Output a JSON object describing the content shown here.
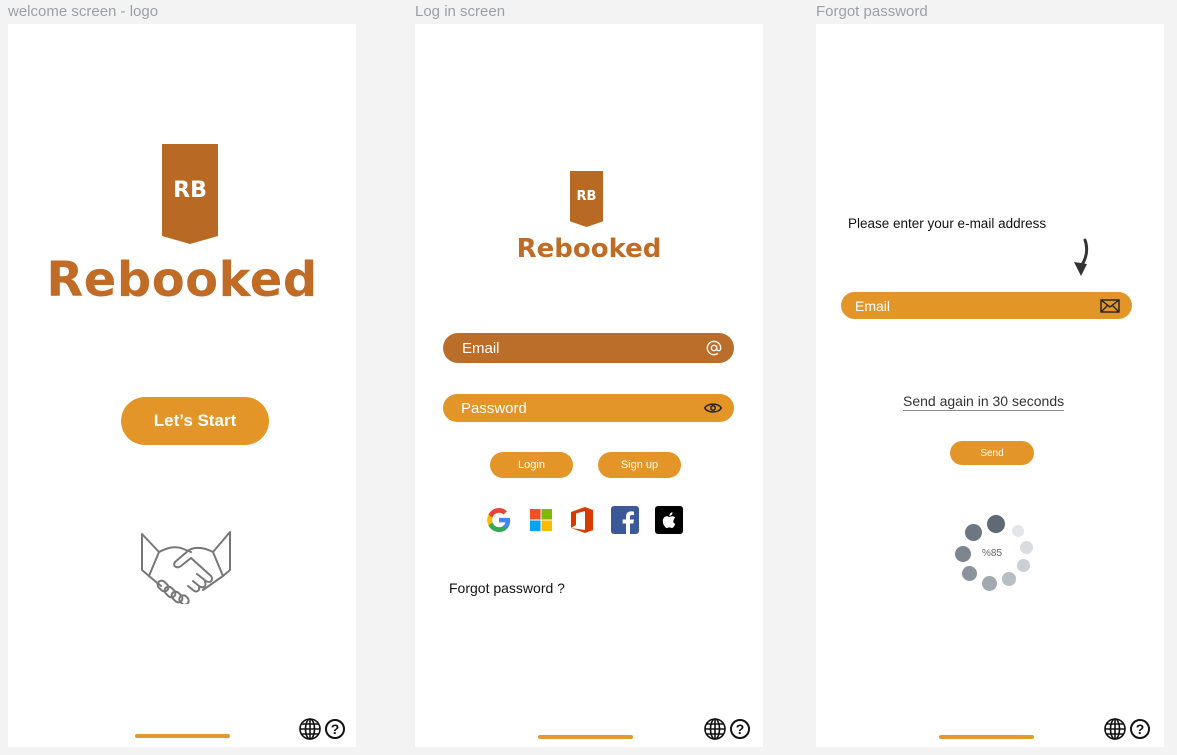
{
  "screens": {
    "welcome": {
      "label": "welcome screen - logo",
      "logo_initials": "RB",
      "brand_name": "Rebooked",
      "start_button": "Let’s Start"
    },
    "login": {
      "label": "Log in screen",
      "logo_initials": "RB",
      "brand_name": "Rebooked",
      "email_placeholder": "Email",
      "password_placeholder": "Password",
      "login_button": "Login",
      "signup_button": "Sign up",
      "social": [
        "google-icon",
        "microsoft-icon",
        "office-icon",
        "facebook-icon",
        "apple-icon"
      ],
      "forgot_link": "Forgot password ?"
    },
    "forgot": {
      "label": "Forgot password",
      "prompt": "Please enter your e-mail address",
      "email_placeholder": "Email",
      "resend_text": "Send again in 30 seconds",
      "send_button": "Send",
      "progress_text": "%85",
      "progress_value": 85
    }
  },
  "colors": {
    "brand_brown": "#b86a25",
    "brand_orange": "#e39627",
    "email_field_login": "#bb6d2a",
    "frame_background": "#ffffff",
    "canvas_background": "#f3f3f3"
  }
}
